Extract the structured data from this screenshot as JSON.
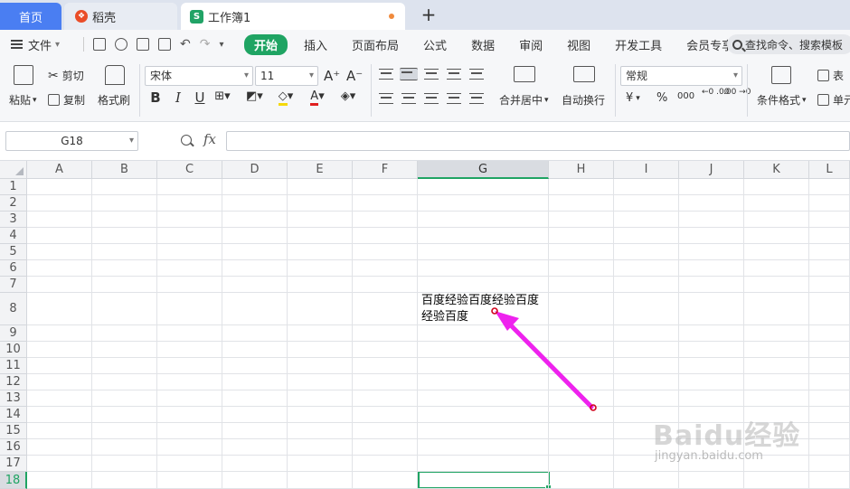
{
  "tabs": {
    "home": "首页",
    "daoke": "稻壳",
    "workbook": "工作簿1",
    "new_tab": "+"
  },
  "menu": {
    "file": "文件",
    "items": [
      "开始",
      "插入",
      "页面布局",
      "公式",
      "数据",
      "审阅",
      "视图",
      "开发工具",
      "会员专享"
    ],
    "search_placeholder": "查找命令、搜索模板"
  },
  "ribbon": {
    "paste": "粘贴",
    "cut": "剪切",
    "copy": "复制",
    "format_painter": "格式刷",
    "font_name": "宋体",
    "font_size": "11",
    "bold": "B",
    "italic": "I",
    "underline": "U",
    "merge_center": "合并居中",
    "wrap_text": "自动换行",
    "number_format": "常规",
    "currency": "¥",
    "percent": "%",
    "thousands": "000",
    "conditional_format": "条件格式",
    "table_style": "表",
    "cell": "单元"
  },
  "formula_bar": {
    "name_box": "G18",
    "fx": "fx",
    "value": ""
  },
  "grid": {
    "columns": [
      "A",
      "B",
      "C",
      "D",
      "E",
      "F",
      "G",
      "H",
      "I",
      "J",
      "K",
      "L"
    ],
    "selected_column": "G",
    "rows": [
      "1",
      "2",
      "3",
      "4",
      "5",
      "6",
      "7",
      "8",
      "9",
      "10",
      "11",
      "12",
      "13",
      "14",
      "15",
      "16",
      "17",
      "18"
    ],
    "selected_row": "18",
    "cell_g8": "百度经验百度经验百度经验百度"
  },
  "watermark": {
    "brand": "Baidu经验",
    "url": "jingyan.baidu.com"
  },
  "colors": {
    "accent_green": "#1fa463",
    "home_tab_blue": "#4a7ef2",
    "annotation_magenta": "#ee22ee"
  }
}
